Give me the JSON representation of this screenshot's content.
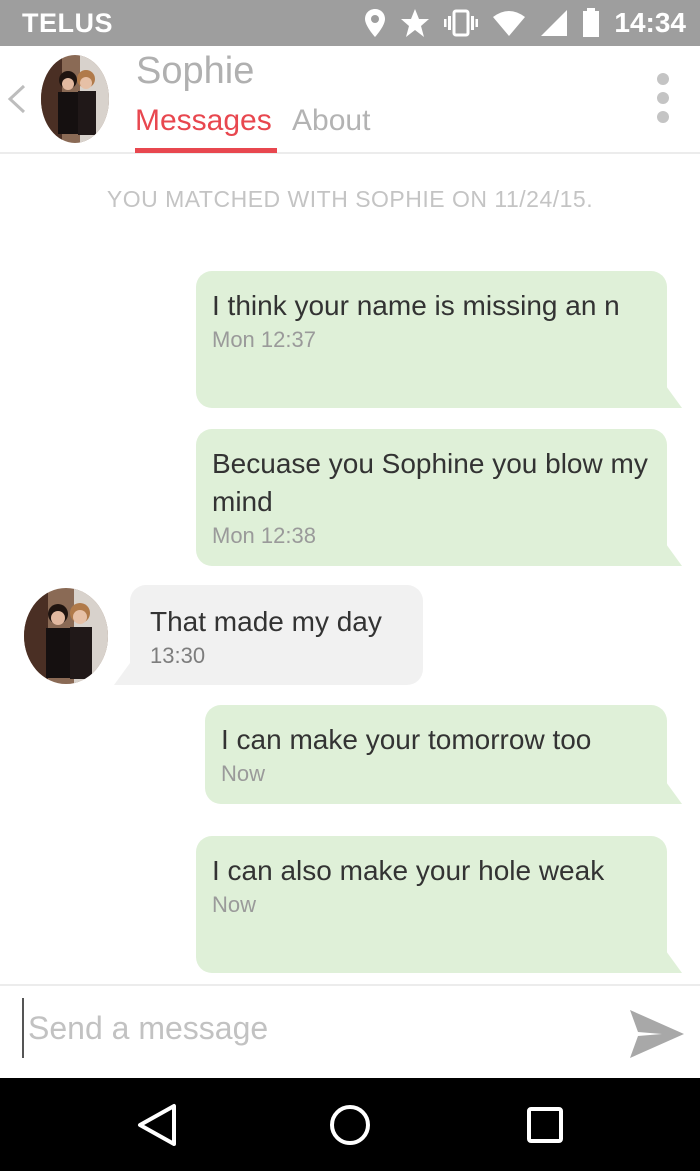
{
  "status_bar": {
    "carrier": "TELUS",
    "time": "14:34",
    "icons": [
      "location-icon",
      "star-icon",
      "vibrate-icon",
      "wifi-icon",
      "signal-icon",
      "battery-icon"
    ]
  },
  "header": {
    "contact_name": "Sophie",
    "tabs": [
      {
        "label": "Messages",
        "active": true
      },
      {
        "label": "About",
        "active": false
      }
    ]
  },
  "conversation": {
    "match_note": "YOU MATCHED WITH SOPHIE ON 11/24/15.",
    "messages": [
      {
        "direction": "outgoing",
        "text": "I think your name is missing an n",
        "time": "Mon 12:37"
      },
      {
        "direction": "outgoing",
        "text": "Becuase you Sophine you blow my mind",
        "time": "Mon 12:38"
      },
      {
        "direction": "incoming",
        "text": "That made my day",
        "time": "13:30"
      },
      {
        "direction": "outgoing",
        "text": "I can make your tomorrow too",
        "time": "Now"
      },
      {
        "direction": "outgoing",
        "text": "I can also make your hole weak",
        "time": "Now"
      }
    ]
  },
  "composer": {
    "placeholder": "Send a message",
    "value": ""
  },
  "colors": {
    "accent": "#e8474f",
    "outgoing_bubble": "#dff0d8",
    "incoming_bubble": "#f1f1f1",
    "status_bar": "#9e9e9e"
  }
}
